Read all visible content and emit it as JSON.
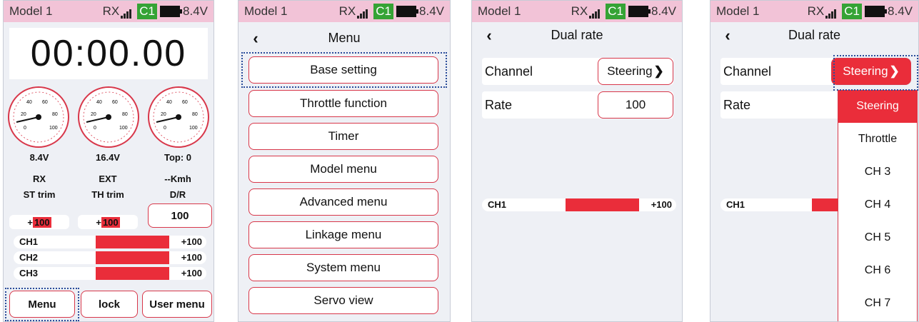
{
  "status": {
    "model": "Model 1",
    "rx_label": "RX",
    "channel_badge": "C1",
    "voltage": "8.4V"
  },
  "colors": {
    "accent": "#ea2d3a",
    "status_bar": "#f2c3d7",
    "badge_green": "#35a335",
    "focus_outline": "#2a4c9a"
  },
  "home": {
    "timer": "00:00.00",
    "gauges": [
      {
        "value": "8.4V",
        "label": "RX",
        "scale": [
          "20",
          "40",
          "60",
          "80",
          "100",
          "0"
        ]
      },
      {
        "value": "16.4V",
        "label": "EXT",
        "scale": [
          "20",
          "40",
          "60",
          "80",
          "100",
          "0"
        ]
      },
      {
        "value": "Top: 0",
        "label": "--Kmh",
        "scale": [
          "20",
          "40",
          "60",
          "80",
          "100",
          "0"
        ]
      }
    ],
    "trims": [
      {
        "label": "ST trim",
        "sign": "+",
        "value": "100"
      },
      {
        "label": "TH trim",
        "sign": "+",
        "value": "100"
      },
      {
        "label": "D/R",
        "value": "100"
      }
    ],
    "channels": [
      {
        "name": "CH1",
        "value": "+100"
      },
      {
        "name": "CH2",
        "value": "+100"
      },
      {
        "name": "CH3",
        "value": "+100"
      }
    ],
    "buttons": {
      "menu": "Menu",
      "lock": "lock",
      "user_menu": "User menu"
    }
  },
  "menu": {
    "title": "Menu",
    "back_icon": "chevron-left-icon",
    "items": [
      "Base setting",
      "Throttle function",
      "Timer",
      "Model menu",
      "Advanced menu",
      "Linkage menu",
      "System menu",
      "Servo view"
    ]
  },
  "dual_rate": {
    "title": "Dual rate",
    "channel_label": "Channel",
    "channel_value": "Steering",
    "rate_label": "Rate",
    "rate_value": "100",
    "ch_name": "CH1",
    "ch_value": "+100"
  },
  "dropdown": {
    "selected": "Steering",
    "options": [
      "Steering",
      "Throttle",
      "CH 3",
      "CH 4",
      "CH 5",
      "CH 6",
      "CH 7"
    ]
  }
}
